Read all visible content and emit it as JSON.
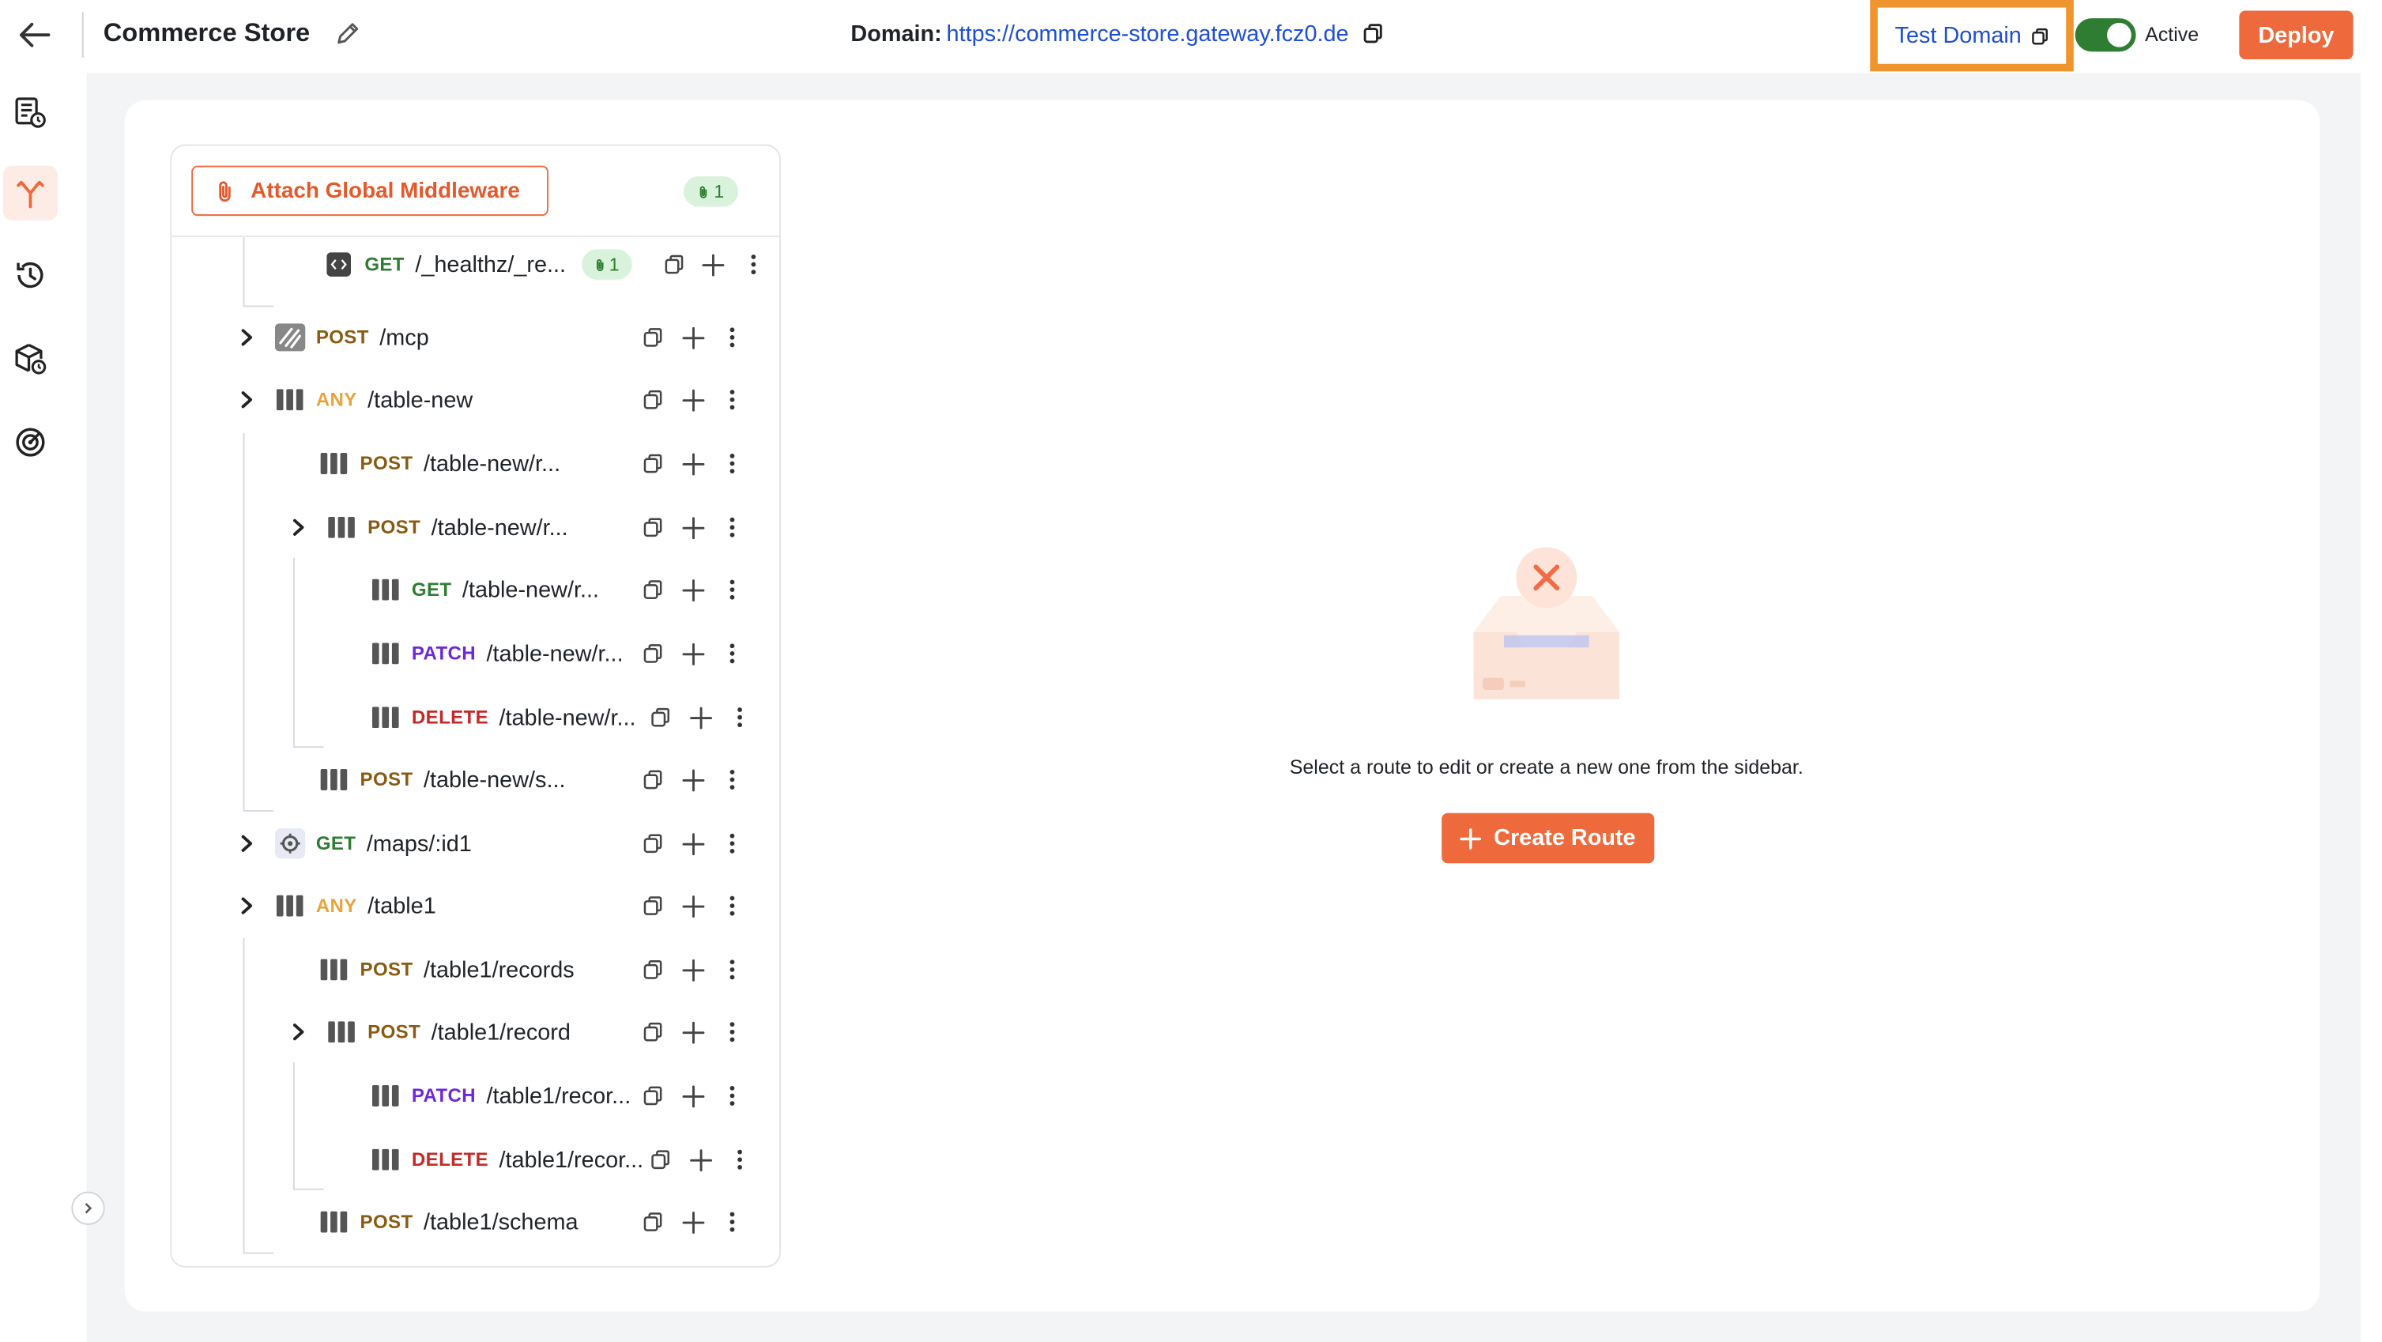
{
  "header": {
    "title": "Commerce Store",
    "domain_label": "Domain:",
    "domain_url": "https://commerce-store.gateway.fcz0.de",
    "test_domain_label": "Test Domain",
    "active_label": "Active",
    "deploy_label": "Deploy"
  },
  "sidebar": {
    "items": [
      {
        "icon": "document-clock-icon"
      },
      {
        "icon": "routes-fork-icon",
        "active": true
      },
      {
        "icon": "history-icon"
      },
      {
        "icon": "package-clock-icon"
      },
      {
        "icon": "radar-icon"
      }
    ]
  },
  "routes_panel": {
    "attach_label": "Attach Global Middleware",
    "middleware_count": "1",
    "routes": [
      {
        "method": "GET",
        "path": "/_healthz/_re...",
        "icon": "code-icon",
        "badge": "1"
      },
      {
        "method": "POST",
        "path": "/mcp",
        "icon": "stripes-icon",
        "expandable": true
      },
      {
        "method": "ANY",
        "path": "/table-new",
        "icon": "table-icon",
        "expandable": true
      },
      {
        "method": "POST",
        "path": "/table-new/r...",
        "icon": "table-icon"
      },
      {
        "method": "POST",
        "path": "/table-new/r...",
        "icon": "table-icon",
        "expandable": true
      },
      {
        "method": "GET",
        "path": "/table-new/r...",
        "icon": "table-icon"
      },
      {
        "method": "PATCH",
        "path": "/table-new/r...",
        "icon": "table-icon"
      },
      {
        "method": "DELETE",
        "path": "/table-new/r...",
        "icon": "table-icon"
      },
      {
        "method": "POST",
        "path": "/table-new/s...",
        "icon": "table-icon"
      },
      {
        "method": "GET",
        "path": "/maps/:id1",
        "icon": "gear-icon",
        "expandable": true
      },
      {
        "method": "ANY",
        "path": "/table1",
        "icon": "table-icon",
        "expandable": true
      },
      {
        "method": "POST",
        "path": "/table1/records",
        "icon": "table-icon"
      },
      {
        "method": "POST",
        "path": "/table1/record",
        "icon": "table-icon",
        "expandable": true
      },
      {
        "method": "PATCH",
        "path": "/table1/recor...",
        "icon": "table-icon"
      },
      {
        "method": "DELETE",
        "path": "/table1/recor...",
        "icon": "table-icon"
      },
      {
        "method": "POST",
        "path": "/table1/schema",
        "icon": "table-icon"
      }
    ]
  },
  "empty_state": {
    "message": "Select a route to edit or create a new one from the sidebar.",
    "create_label": "Create Route"
  },
  "colors": {
    "accent": "#ee6a3d",
    "link": "#1d4ed8",
    "toggle_on": "#2f7d32",
    "highlight_border": "#f0952e"
  }
}
